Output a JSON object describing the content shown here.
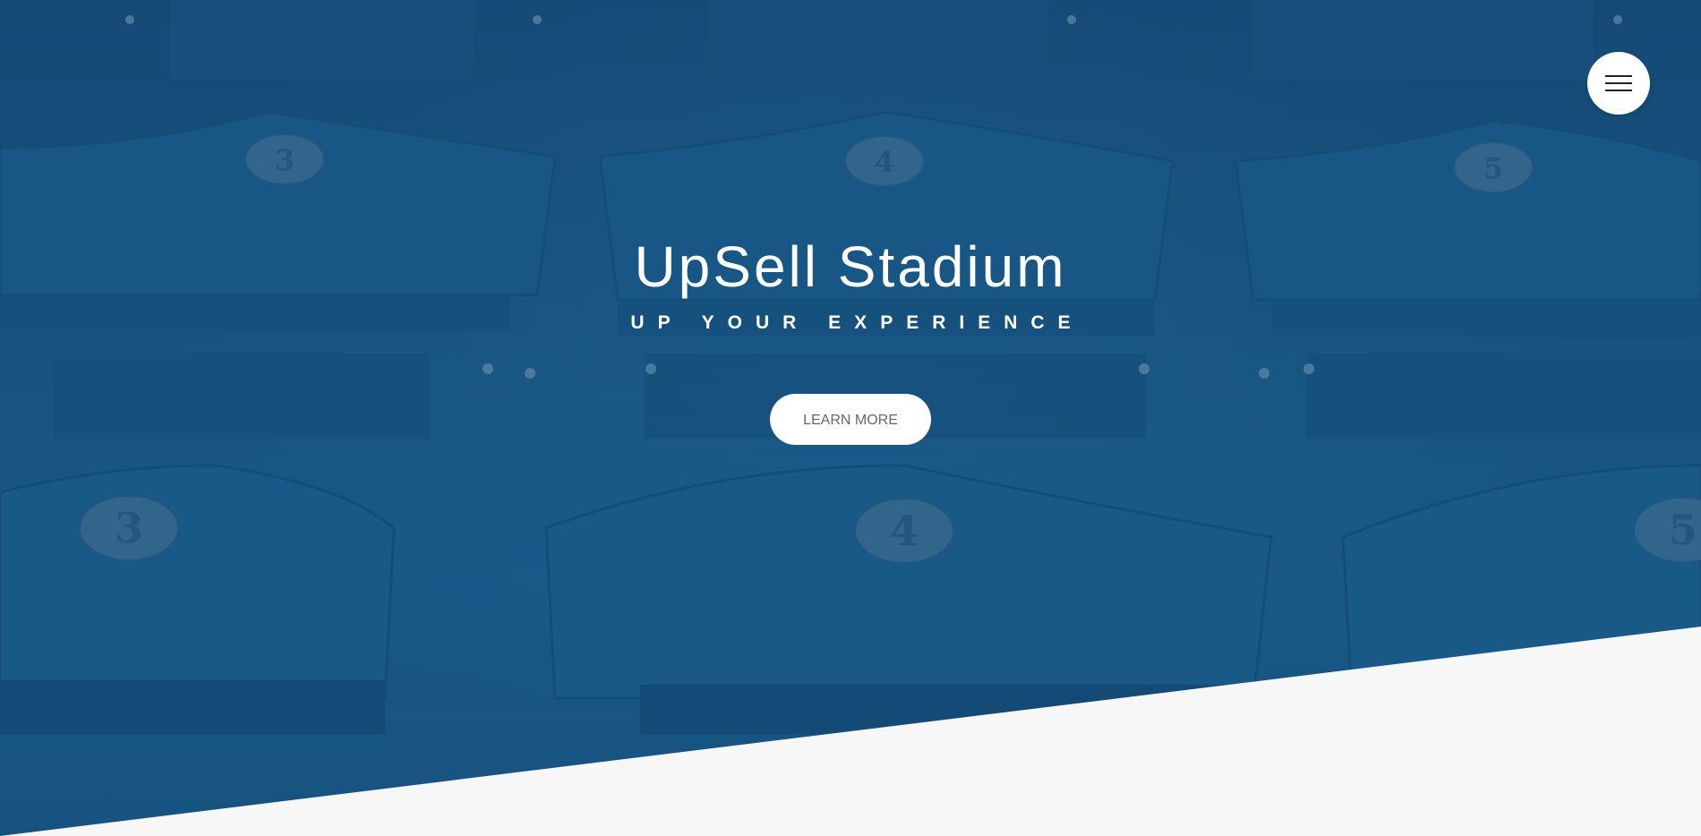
{
  "hero": {
    "title": "UpSell Stadium",
    "subtitle": "UP YOUR EXPERIENCE",
    "cta_label": "LEARN MORE"
  },
  "menu": {
    "icon": "hamburger-menu-icon"
  },
  "seat_numbers": {
    "top_left": "3",
    "top_center": "4",
    "top_right": "5",
    "bottom_left": "3",
    "bottom_center": "4",
    "bottom_right": "5"
  },
  "colors": {
    "overlay": "#185481",
    "page_background": "#f7f7f7",
    "button_background": "#ffffff",
    "button_text": "#666666",
    "title_text": "#ffffff"
  }
}
